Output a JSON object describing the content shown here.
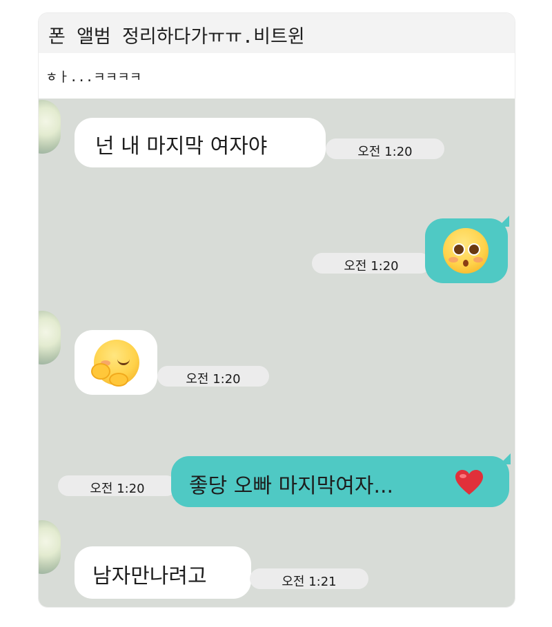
{
  "post": {
    "title": "폰 앨범 정리하다가ㅠㅠ.비트윈",
    "caption": "ㅎㅏ...ㅋㅋㅋㅋ"
  },
  "chat": {
    "messages": [
      {
        "direction": "incoming",
        "type": "text",
        "text": "넌 내 마지막 여자야",
        "time": "오전 1:20"
      },
      {
        "direction": "outgoing",
        "type": "emoji",
        "emoji": "blushing-face-emoji",
        "time": "오전 1:20"
      },
      {
        "direction": "incoming",
        "type": "emoji",
        "emoji": "hugging-face-emoji",
        "time": "오전 1:20"
      },
      {
        "direction": "outgoing",
        "type": "text",
        "text": "좋당 오빠 마지막여자...",
        "emoji": "heart-emoji",
        "time": "오전 1:20"
      },
      {
        "direction": "incoming",
        "type": "text",
        "text": "남자만나려고",
        "time": "오전 1:21"
      }
    ]
  },
  "colors": {
    "chat_background": "#d8dcd7",
    "incoming_bubble": "#ffffff",
    "outgoing_bubble": "#4fc9c4",
    "time_pill": "#ececec",
    "heart": "#e0303a"
  }
}
